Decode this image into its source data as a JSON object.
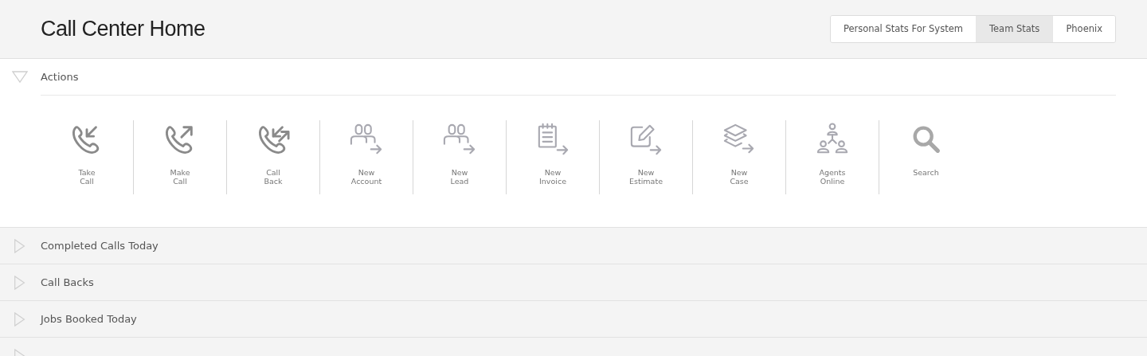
{
  "page_title": "Call Center Home",
  "stats_tabs": [
    {
      "label": "Personal Stats For System",
      "selected": false
    },
    {
      "label": "Team Stats",
      "selected": true
    },
    {
      "label": "Phoenix",
      "selected": false
    }
  ],
  "sections": [
    {
      "title": "Actions",
      "expanded": true,
      "actions": [
        {
          "kind": "incoming",
          "label": [
            "Take",
            "Call"
          ]
        },
        {
          "kind": "outgoing",
          "label": [
            "Make",
            "Call"
          ]
        },
        {
          "kind": "callback",
          "label": [
            "Call",
            "Back"
          ]
        },
        {
          "kind": "people",
          "label": [
            "New",
            "Account"
          ]
        },
        {
          "kind": "people",
          "label": [
            "New",
            "Lead"
          ]
        },
        {
          "kind": "invoice",
          "label": [
            "New",
            "Invoice"
          ]
        },
        {
          "kind": "edit",
          "label": [
            "New",
            "Estimate"
          ]
        },
        {
          "kind": "layers",
          "label": [
            "New",
            "Case"
          ]
        },
        {
          "kind": "org",
          "label": [
            "Agents",
            "Online"
          ]
        },
        {
          "kind": "search",
          "label": [
            "Search"
          ]
        }
      ]
    },
    {
      "title": "Completed Calls Today",
      "expanded": false
    },
    {
      "title": "Call Backs",
      "expanded": false
    },
    {
      "title": "Jobs Booked Today",
      "expanded": false
    },
    {
      "expanded": false
    }
  ]
}
